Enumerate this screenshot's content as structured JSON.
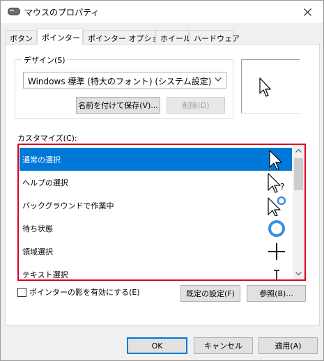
{
  "window": {
    "title": "マウスのプロパティ"
  },
  "tabs": [
    {
      "label": "ボタン"
    },
    {
      "label": "ポインター"
    },
    {
      "label": "ポインター オプション"
    },
    {
      "label": "ホイール"
    },
    {
      "label": "ハードウェア"
    }
  ],
  "design": {
    "legend": "デザイン(S)",
    "scheme_value": "Windows 標準 (特大のフォント) (システム設定)",
    "save_as_label": "名前を付けて保存(V)...",
    "delete_label": "削除(D)"
  },
  "customize": {
    "label": "カスタマイズ(C):",
    "items": [
      {
        "label": "通常の選択",
        "icon": "arrow-pointer-icon"
      },
      {
        "label": "ヘルプの選択",
        "icon": "help-pointer-icon"
      },
      {
        "label": "バックグラウンドで作業中",
        "icon": "working-background-icon"
      },
      {
        "label": "待ち状態",
        "icon": "busy-ring-icon"
      },
      {
        "label": "領域選択",
        "icon": "crosshair-icon"
      },
      {
        "label": "テキスト選択",
        "icon": "text-ibeam-icon"
      }
    ]
  },
  "shadow_checkbox_label": "ポインターの影を有効にする(E)",
  "buttons": {
    "use_default": "既定の設定(F)",
    "browse": "参照(B)...",
    "ok": "OK",
    "cancel": "キャンセル",
    "apply": "適用(A)"
  },
  "colors": {
    "accent": "#0078d7",
    "highlight_border": "#e0001b"
  }
}
